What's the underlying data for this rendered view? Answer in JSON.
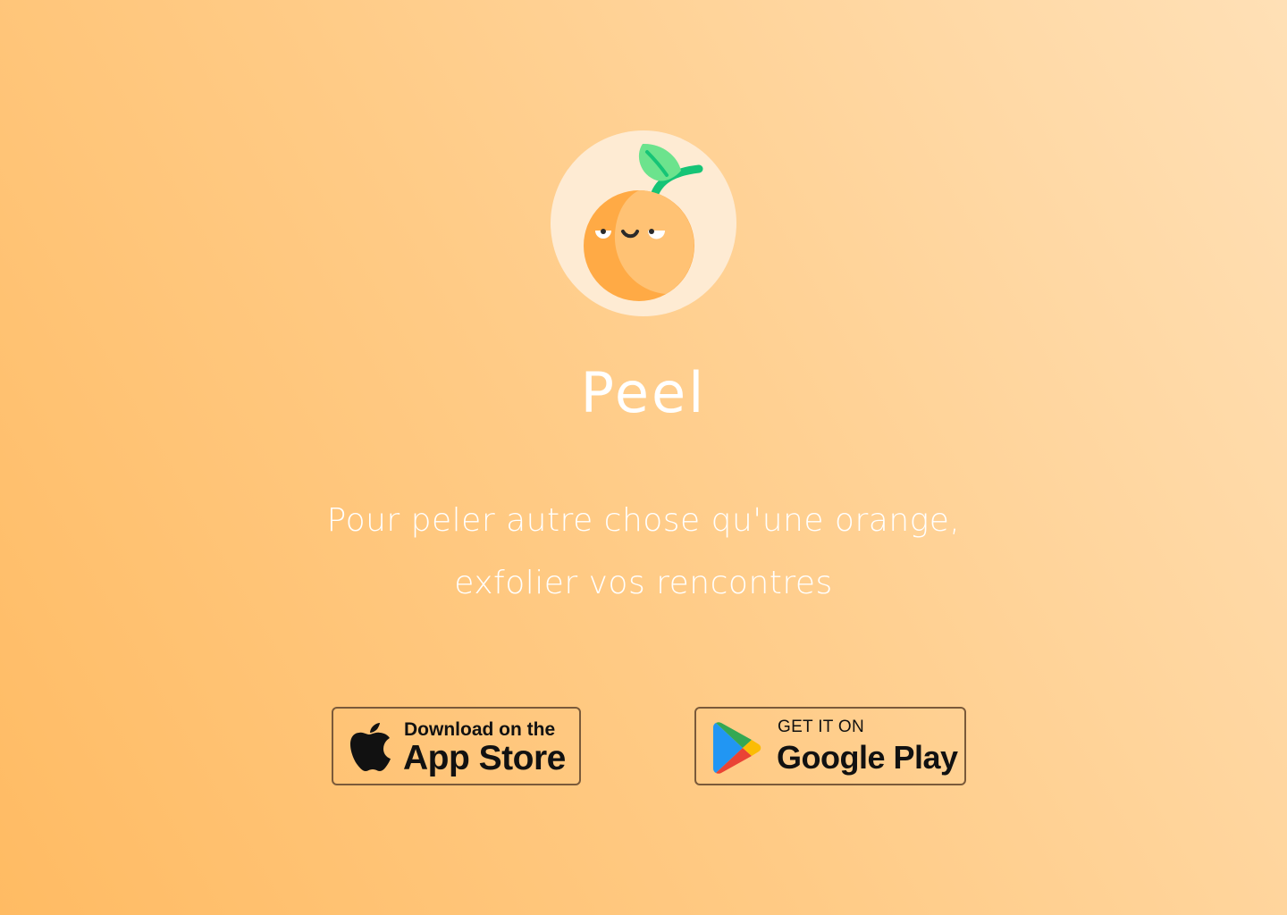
{
  "app": {
    "name": "Peel",
    "logo_icon": "orange-mascot-icon"
  },
  "tagline": {
    "line1": "Pour peler autre chose qu'une orange,",
    "line2": "exfolier vos rencontres"
  },
  "downloads": {
    "app_store": {
      "small_label": "Download on the",
      "big_label": "App Store",
      "icon": "apple-icon"
    },
    "google_play": {
      "small_label": "GET IT ON",
      "big_label": "Google Play",
      "icon": "google-play-icon"
    }
  },
  "colors": {
    "background_start": "#ffbb63",
    "background_end": "#ffe0b6",
    "text": "#ffffff",
    "badge_border": "#7a5a3a"
  }
}
